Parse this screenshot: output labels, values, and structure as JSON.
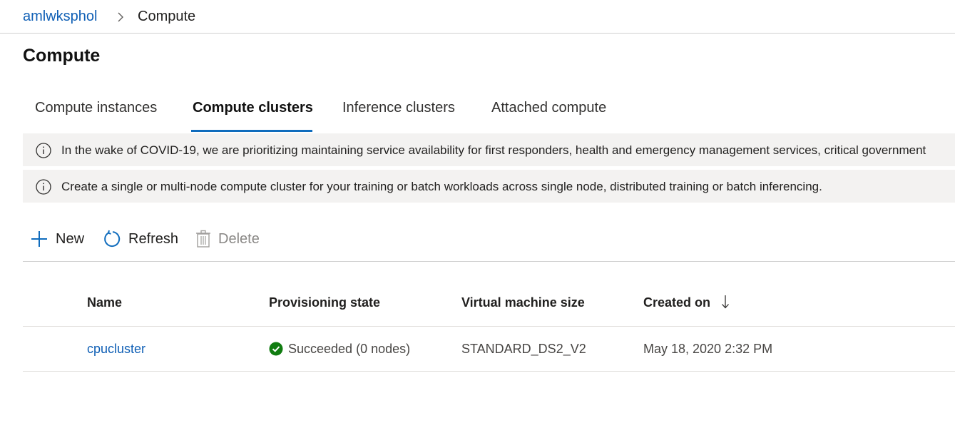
{
  "breadcrumb": {
    "workspace": "amlwksphol",
    "current": "Compute"
  },
  "page": {
    "title": "Compute"
  },
  "tabs": [
    {
      "label": "Compute instances"
    },
    {
      "label": "Compute clusters"
    },
    {
      "label": "Inference clusters"
    },
    {
      "label": "Attached compute"
    }
  ],
  "active_tab": "Compute clusters",
  "banners": [
    {
      "icon": "info-icon",
      "text": "In the wake of COVID-19, we are prioritizing maintaining service availability for first responders, health and emergency management services, critical government"
    },
    {
      "icon": "info-icon",
      "text": "Create a single or multi-node compute cluster for your training or batch workloads across single node, distributed training or batch inferencing."
    }
  ],
  "toolbar": {
    "new_label": "New",
    "refresh_label": "Refresh",
    "delete_label": "Delete"
  },
  "table": {
    "columns": [
      "Name",
      "Provisioning state",
      "Virtual machine size",
      "Created on"
    ],
    "sort": {
      "column": "Created on",
      "direction": "descending"
    },
    "rows": [
      {
        "name": "cpucluster",
        "state": "Succeeded (0 nodes)",
        "vm_size": "STANDARD_DS2_V2",
        "created": "May 18, 2020 2:32 PM"
      }
    ]
  },
  "colors": {
    "link": "#0f5fb5",
    "accent": "#0f6cbd",
    "success": "#107c10",
    "banner_bg": "#f3f2f1"
  }
}
